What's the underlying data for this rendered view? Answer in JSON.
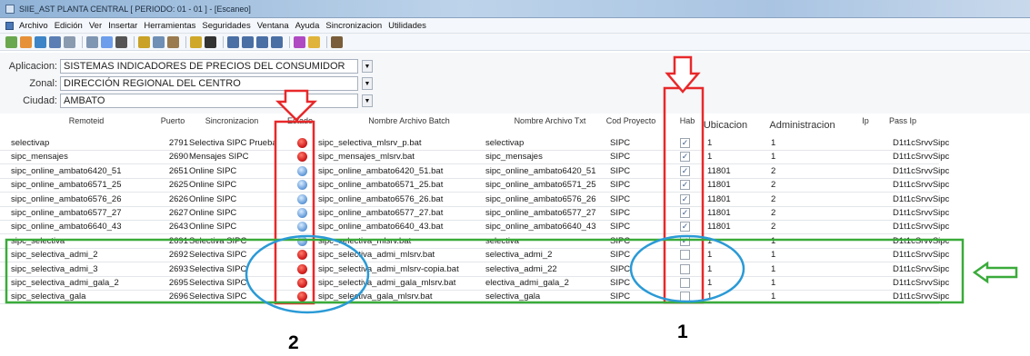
{
  "window": {
    "title": "SIIE_AST PLANTA CENTRAL [ PERIODO: 01 - 01 ] - [Escaneo]"
  },
  "menubar": {
    "items": [
      "Archivo",
      "Edición",
      "Ver",
      "Insertar",
      "Herramientas",
      "Seguridades",
      "Ventana",
      "Ayuda",
      "Sincronizacion",
      "Utilidades"
    ]
  },
  "toolbar": {
    "icons": [
      "new-icon",
      "open-icon",
      "grid-icon",
      "save-icon",
      "print-icon",
      "preview-icon",
      "refresh-icon",
      "delete-icon",
      "cut-icon",
      "copy-icon",
      "paste-icon",
      "pin-icon",
      "binoculars-icon",
      "first-icon",
      "prev-icon",
      "next-icon",
      "last-icon",
      "link-icon",
      "folder-icon",
      "exit-icon"
    ]
  },
  "filters": {
    "aplicacion_label": "Aplicacion:",
    "aplicacion_value": "SISTEMAS INDICADORES DE PRECIOS DEL CONSUMIDOR",
    "zonal_label": "Zonal:",
    "zonal_value": "DIRECCIÓN REGIONAL DEL CENTRO",
    "ciudad_label": "Ciudad:",
    "ciudad_value": "AMBATO"
  },
  "table": {
    "headers": {
      "remoteid": "Remoteid",
      "puerto": "Puerto",
      "sincronizacion": "Sincronizacion",
      "estado": "Estado",
      "archivo_batch": "Nombre Archivo Batch",
      "archivo_txt": "Nombre Archivo Txt",
      "cod_proyecto": "Cod Proyecto",
      "hab": "Hab",
      "ubicacion": "Ubicacion",
      "administracion": "Administracion",
      "ip": "Ip",
      "pass_ip": "Pass Ip"
    },
    "rows": [
      {
        "remoteid": "selectivap",
        "puerto": "2791",
        "sync": "Selectiva SIPC Prueba",
        "estado": "red",
        "batch": "sipc_selectiva_mlsrv_p.bat",
        "txt": "selectivap",
        "cod": "SIPC",
        "hab": true,
        "ubic": "1",
        "admin": "1",
        "ip": "",
        "pass": "D1t1cSrvvSipc"
      },
      {
        "remoteid": "sipc_mensajes",
        "puerto": "2690",
        "sync": "Mensajes SIPC",
        "estado": "red",
        "batch": "sipc_mensajes_mlsrv.bat",
        "txt": "sipc_mensajes",
        "cod": "SIPC",
        "hab": true,
        "ubic": "1",
        "admin": "1",
        "ip": "",
        "pass": "D1t1cSrvvSipc"
      },
      {
        "remoteid": "sipc_online_ambato6420_51",
        "puerto": "2651",
        "sync": "Online SIPC",
        "estado": "blue",
        "batch": "sipc_online_ambato6420_51.bat",
        "txt": "sipc_online_ambato6420_51",
        "cod": "SIPC",
        "hab": true,
        "ubic": "11801",
        "admin": "2",
        "ip": "",
        "pass": "D1t1cSrvvSipc"
      },
      {
        "remoteid": "sipc_online_ambato6571_25",
        "puerto": "2625",
        "sync": "Online SIPC",
        "estado": "blue",
        "batch": "sipc_online_ambato6571_25.bat",
        "txt": "sipc_online_ambato6571_25",
        "cod": "SIPC",
        "hab": true,
        "ubic": "11801",
        "admin": "2",
        "ip": "",
        "pass": "D1t1cSrvvSipc"
      },
      {
        "remoteid": "sipc_online_ambato6576_26",
        "puerto": "2626",
        "sync": "Online SIPC",
        "estado": "blue",
        "batch": "sipc_online_ambato6576_26.bat",
        "txt": "sipc_online_ambato6576_26",
        "cod": "SIPC",
        "hab": true,
        "ubic": "11801",
        "admin": "2",
        "ip": "",
        "pass": "D1t1cSrvvSipc"
      },
      {
        "remoteid": "sipc_online_ambato6577_27",
        "puerto": "2627",
        "sync": "Online SIPC",
        "estado": "blue",
        "batch": "sipc_online_ambato6577_27.bat",
        "txt": "sipc_online_ambato6577_27",
        "cod": "SIPC",
        "hab": true,
        "ubic": "11801",
        "admin": "2",
        "ip": "",
        "pass": "D1t1cSrvvSipc"
      },
      {
        "remoteid": "sipc_online_ambato6640_43",
        "puerto": "2643",
        "sync": "Online SIPC",
        "estado": "blue",
        "batch": "sipc_online_ambato6640_43.bat",
        "txt": "sipc_online_ambato6640_43",
        "cod": "SIPC",
        "hab": true,
        "ubic": "11801",
        "admin": "2",
        "ip": "",
        "pass": "D1t1cSrvvSipc"
      },
      {
        "remoteid": "sipc_selectiva",
        "puerto": "2691",
        "sync": "Selectiva SIPC",
        "estado": "blue",
        "batch": "sipc_selectiva_mlsrv.bat",
        "txt": "selectiva",
        "cod": "SIPC",
        "hab": true,
        "ubic": "1",
        "admin": "1",
        "ip": "",
        "pass": "D1t1cSrvvSipc"
      },
      {
        "remoteid": "sipc_selectiva_admi_2",
        "puerto": "2692",
        "sync": "Selectiva SIPC",
        "estado": "red",
        "batch": "sipc_selectiva_admi_mlsrv.bat",
        "txt": "selectiva_admi_2",
        "cod": "SIPC",
        "hab": false,
        "ubic": "1",
        "admin": "1",
        "ip": "",
        "pass": "D1t1cSrvvSipc"
      },
      {
        "remoteid": "sipc_selectiva_admi_3",
        "puerto": "2693",
        "sync": "Selectiva SIPC",
        "estado": "red",
        "batch": "sipc_selectiva_admi_mlsrv-copia.bat",
        "txt": "selectiva_admi_22",
        "cod": "SIPC",
        "hab": false,
        "ubic": "1",
        "admin": "1",
        "ip": "",
        "pass": "D1t1cSrvvSipc"
      },
      {
        "remoteid": "sipc_selectiva_admi_gala_2",
        "puerto": "2695",
        "sync": "Selectiva SIPC",
        "estado": "red",
        "batch": "sipc_selectiva_admi_gala_mlsrv.bat",
        "txt": "electiva_admi_gala_2",
        "cod": "SIPC",
        "hab": false,
        "ubic": "1",
        "admin": "1",
        "ip": "",
        "pass": "D1t1cSrvvSipc"
      },
      {
        "remoteid": "sipc_selectiva_gala",
        "puerto": "2696",
        "sync": "Selectiva SIPC",
        "estado": "red",
        "batch": "sipc_selectiva_gala_mlsrv.bat",
        "txt": "selectiva_gala",
        "cod": "SIPC",
        "hab": false,
        "ubic": "1",
        "admin": "1",
        "ip": "",
        "pass": "D1t1cSrvvSipc"
      }
    ]
  },
  "annotations": {
    "label_1": "1",
    "label_2": "2"
  },
  "colors": {
    "estado_red": "#d42020",
    "estado_blue": "#5b95d6",
    "highlight_red": "#e8282a",
    "highlight_green": "#3aab3a",
    "highlight_blue": "#2a9ad6"
  }
}
